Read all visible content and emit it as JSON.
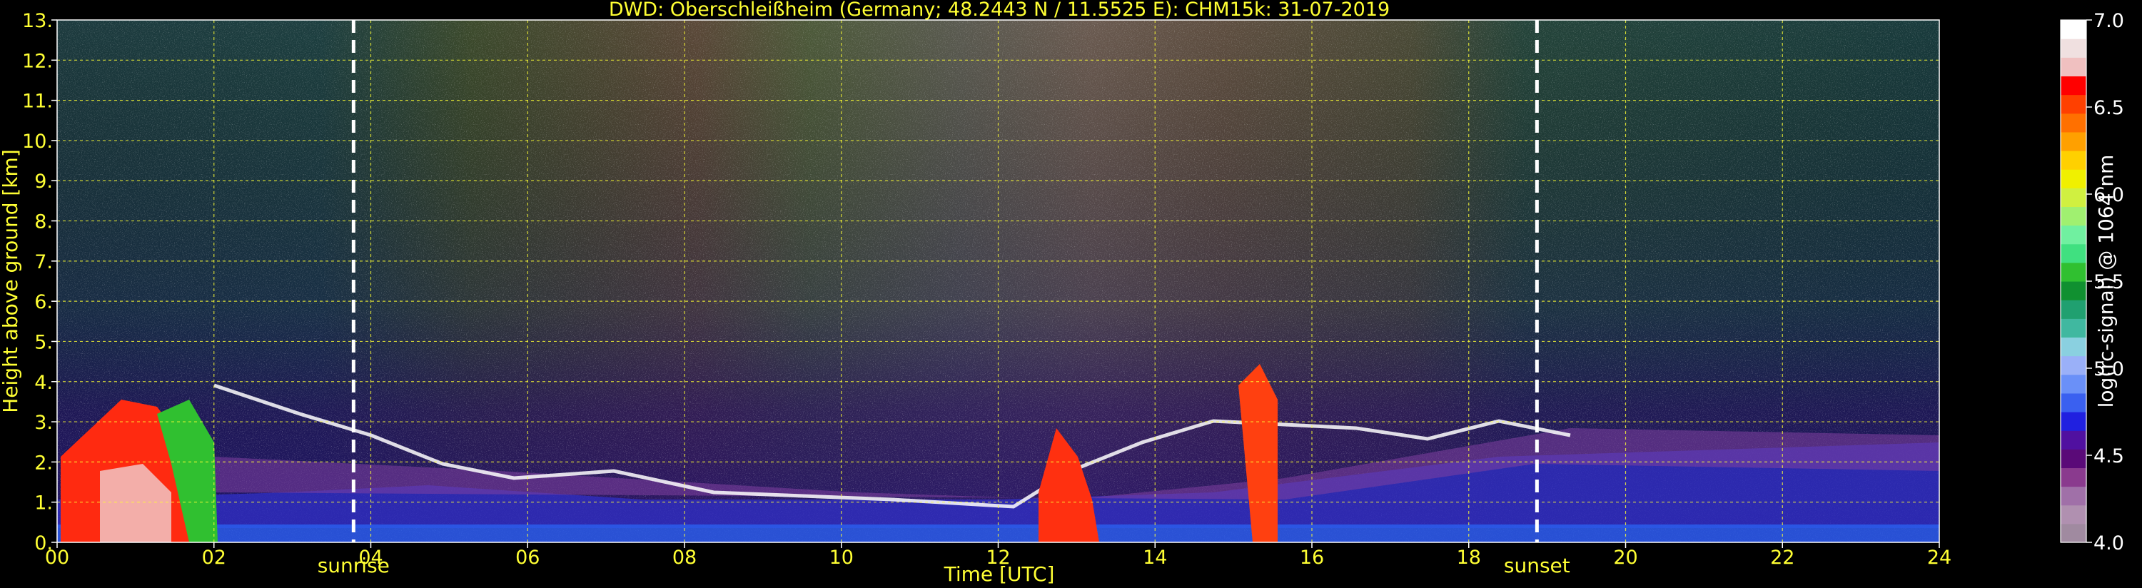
{
  "chart_data": {
    "type": "heatmap",
    "title": "DWD: Oberschleißheim (Germany; 48.2443 N / 11.5525 E):    CHM15k: 31-07-2019",
    "xlabel": "Time [UTC]",
    "ylabel": "Height above ground [km]",
    "xlim": [
      0,
      24
    ],
    "ylim": [
      0,
      13
    ],
    "x_ticks": [
      0,
      2,
      4,
      6,
      8,
      10,
      12,
      14,
      16,
      18,
      20,
      22,
      24
    ],
    "x_tick_labels": [
      "00",
      "02",
      "04",
      "06",
      "08",
      "10",
      "12",
      "14",
      "16",
      "18",
      "20",
      "22",
      "24"
    ],
    "y_ticks": [
      0,
      1,
      2,
      3,
      4,
      5,
      6,
      7,
      8,
      9,
      10,
      11,
      12,
      13
    ],
    "y_tick_labels": [
      "0.",
      "1.",
      "2.",
      "3.",
      "4.",
      "5.",
      "6.",
      "7.",
      "8.",
      "9.",
      "10.",
      "11.",
      "12.",
      "13."
    ],
    "grid": true,
    "colorbar": {
      "label": "log(rc-signal) @ 1064 nm",
      "range": [
        4.0,
        7.0
      ],
      "ticks": [
        4.0,
        4.5,
        5.0,
        5.5,
        6.0,
        6.5,
        7.0
      ],
      "tick_labels": [
        "4.0",
        "4.5",
        "5.0",
        "5.5",
        "6.0",
        "6.5",
        "7.0"
      ],
      "colors": [
        "#a08aa0",
        "#b090b0",
        "#a070a8",
        "#8a3a8e",
        "#5a0a78",
        "#5010a0",
        "#2020e0",
        "#3a60f0",
        "#6a90f8",
        "#9ab0f8",
        "#8ad0e0",
        "#40b8a0",
        "#20a070",
        "#109030",
        "#30c030",
        "#40e080",
        "#70f0a0",
        "#a0f070",
        "#d0f040",
        "#f0f000",
        "#ffd000",
        "#ffa000",
        "#ff7000",
        "#ff4000",
        "#ff0000",
        "#f0c0c0",
        "#f0e0e0",
        "#ffffff"
      ]
    },
    "events": [
      {
        "label": "sunrise",
        "x": 3.78
      },
      {
        "label": "sunset",
        "x": 18.87
      }
    ],
    "colors": {
      "text": "#ffff33",
      "grid": "#ffff33",
      "background": "#000000",
      "event_line": "#ffffff"
    }
  }
}
